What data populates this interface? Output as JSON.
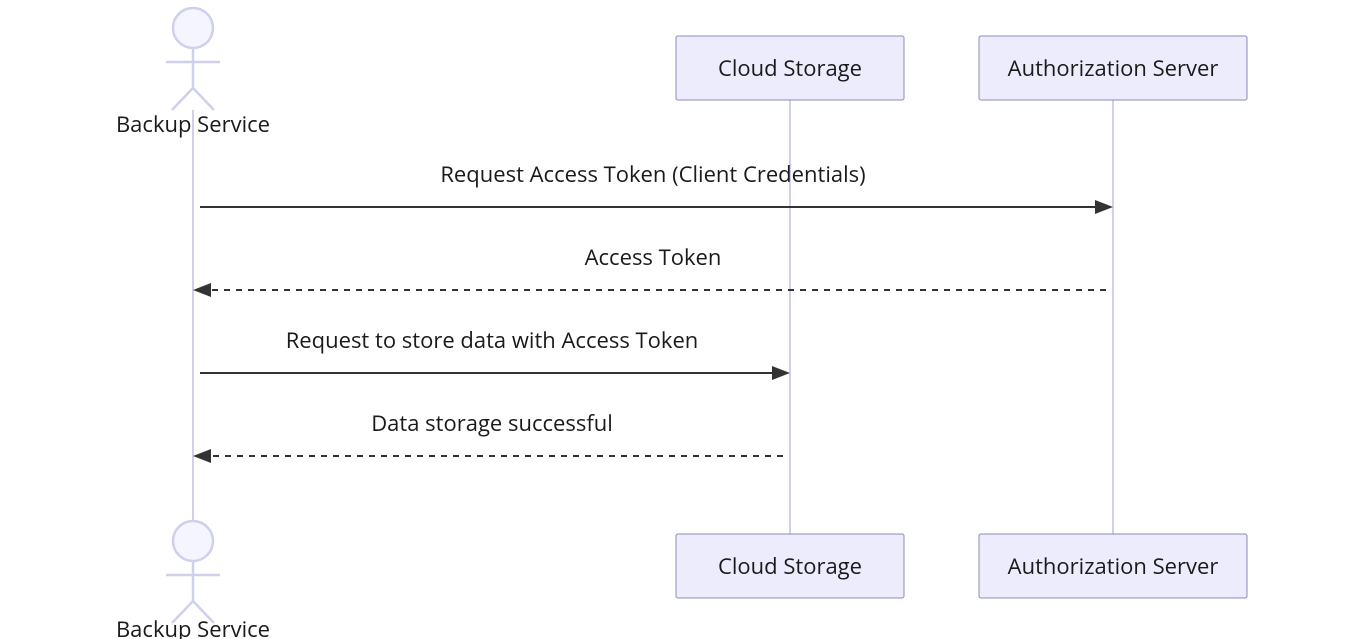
{
  "diagram": {
    "type": "sequence",
    "actors": {
      "client": {
        "label": "Backup Service"
      },
      "storage": {
        "label": "Cloud Storage"
      },
      "auth": {
        "label": "Authorization Server"
      }
    },
    "messages": [
      {
        "from": "client",
        "to": "auth",
        "text": "Request Access Token (Client Credentials)",
        "style": "solid"
      },
      {
        "from": "auth",
        "to": "client",
        "text": "Access Token",
        "style": "dashed"
      },
      {
        "from": "client",
        "to": "storage",
        "text": "Request to store data with Access Token",
        "style": "solid"
      },
      {
        "from": "storage",
        "to": "client",
        "text": "Data storage successful",
        "style": "dashed"
      }
    ]
  }
}
